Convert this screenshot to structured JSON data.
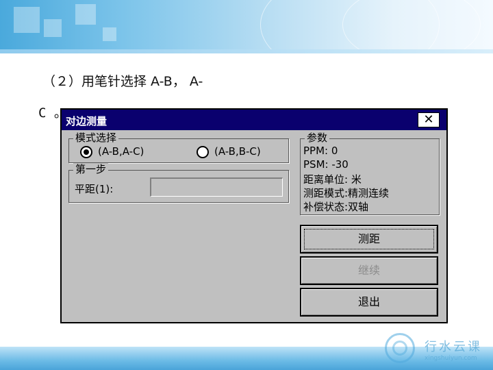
{
  "instruction": {
    "line1": "（２）用笔针选择 A-B，  A-",
    "line2": "C 。"
  },
  "dialog": {
    "title": "对边测量",
    "close_glyph": "✕",
    "mode_group": {
      "label": "模式选择",
      "options": [
        {
          "label": "(A-B,A-C)",
          "selected": true
        },
        {
          "label": "(A-B,B-C)",
          "selected": false
        }
      ]
    },
    "step_group": {
      "label": "第一步",
      "field_label": "平距(1):",
      "field_value": ""
    },
    "params_group": {
      "label": "参数",
      "lines": [
        "PPM:   0",
        "PSM: -30",
        "距离单位: 米",
        "测距模式:精测连续",
        "补偿状态:双轴"
      ]
    },
    "buttons": {
      "measure": "测距",
      "continue": "继续",
      "exit": "退出"
    }
  },
  "watermark": {
    "name": "行水云课",
    "url": "xingshuiyun.com"
  },
  "colors": {
    "titlebar": "#0a006e",
    "dialog_bg": "#c0c0c0",
    "disabled_text": "#8c8c8c"
  }
}
